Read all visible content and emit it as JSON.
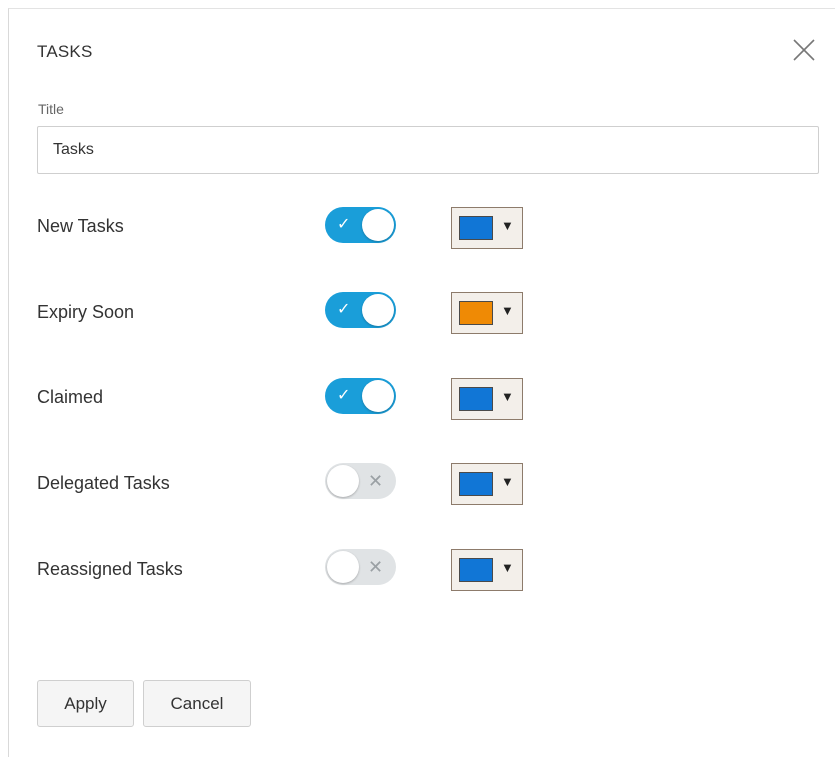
{
  "dialog": {
    "title": "TASKS",
    "close_icon": "close-icon"
  },
  "title_field": {
    "label": "Title",
    "value": "Tasks"
  },
  "rows": [
    {
      "label": "New Tasks",
      "enabled": true,
      "color": "#1176d6"
    },
    {
      "label": "Expiry Soon",
      "enabled": true,
      "color": "#ef8a05"
    },
    {
      "label": "Claimed",
      "enabled": true,
      "color": "#1176d6"
    },
    {
      "label": "Delegated Tasks",
      "enabled": false,
      "color": "#1176d6"
    },
    {
      "label": "Reassigned Tasks",
      "enabled": false,
      "color": "#1176d6"
    }
  ],
  "toggle_marks": {
    "on": "✓",
    "off": "✕"
  },
  "picker_caret": "▼",
  "footer": {
    "apply_label": "Apply",
    "cancel_label": "Cancel"
  },
  "colors": {
    "toggle_on": "#1a9ed9",
    "toggle_off": "#e0e3e5"
  }
}
